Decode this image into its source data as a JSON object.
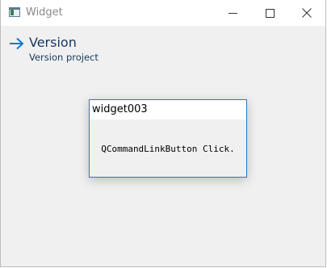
{
  "window": {
    "title": "Widget",
    "icon": "app-window-icon",
    "controls": [
      "minimize-icon",
      "maximize-icon",
      "close-icon"
    ]
  },
  "command_link": {
    "icon": "arrow-right-icon",
    "title": "Version",
    "description": "Version project",
    "accent": "#1979ca",
    "text_color": "#17375e"
  },
  "dialog": {
    "title": "widget003",
    "message": "QCommandLinkButton Click.",
    "border_color": "#2b79c2"
  }
}
